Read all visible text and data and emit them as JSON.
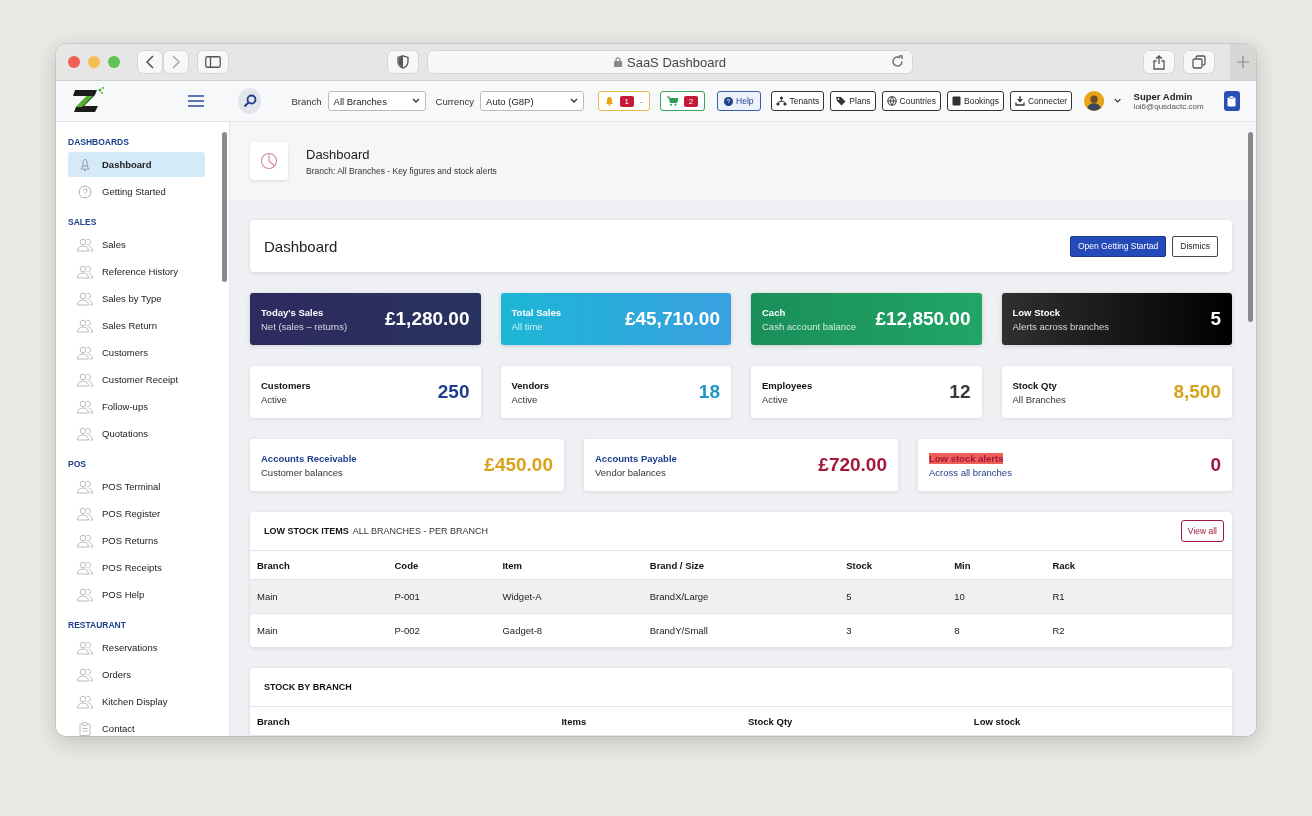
{
  "browser": {
    "address": "SaaS Dashboard"
  },
  "header": {
    "branch_label": "Branch",
    "branch_value": "All Branches",
    "currency_label": "Currency",
    "currency_value": "Auto (G8P)",
    "alerts": [
      {
        "kind": "bell",
        "count": "1",
        "extra": "-"
      },
      {
        "kind": "cart",
        "count": "2"
      }
    ],
    "help": "Help",
    "links": [
      {
        "kind": "tenants",
        "label": "Tenants"
      },
      {
        "kind": "plans",
        "label": "Plans"
      },
      {
        "kind": "countries",
        "label": "Countries"
      },
      {
        "kind": "bookings",
        "label": "Bookings"
      },
      {
        "kind": "connecter",
        "label": "Connecter"
      }
    ],
    "user": {
      "name": "Super Admin",
      "email": "ioi6@qusdactc.com"
    }
  },
  "sidebar": {
    "sections": [
      {
        "title": "DASHBOARDS",
        "items": [
          {
            "label": "Dashboard",
            "kind": "rocket",
            "selected": true
          },
          {
            "label": "Getting Started",
            "kind": "help",
            "selected": false
          }
        ]
      },
      {
        "title": "SALES",
        "items": [
          {
            "label": "Sales",
            "kind": "users",
            "selected": false
          },
          {
            "label": "Reference History",
            "kind": "users",
            "selected": false
          },
          {
            "label": "Sales by Type",
            "kind": "users",
            "selected": false
          },
          {
            "label": "Sales Return",
            "kind": "users",
            "selected": false
          },
          {
            "label": "Customers",
            "kind": "users",
            "selected": false
          },
          {
            "label": "Customer Receipt",
            "kind": "users",
            "selected": false
          },
          {
            "label": "Follow-ups",
            "kind": "users",
            "selected": false
          },
          {
            "label": "Quotations",
            "kind": "users",
            "selected": false
          }
        ]
      },
      {
        "title": "POS",
        "items": [
          {
            "label": "POS Terminal",
            "kind": "users",
            "selected": false
          },
          {
            "label": "POS Register",
            "kind": "users",
            "selected": false
          },
          {
            "label": "POS Returns",
            "kind": "users",
            "selected": false
          },
          {
            "label": "POS Receipts",
            "kind": "users",
            "selected": false
          },
          {
            "label": "POS Help",
            "kind": "users",
            "selected": false
          }
        ]
      },
      {
        "title": "RESTAURANT",
        "items": [
          {
            "label": "Reservations",
            "kind": "users",
            "selected": false
          },
          {
            "label": "Orders",
            "kind": "users",
            "selected": false
          },
          {
            "label": "Kitchen Display",
            "kind": "users",
            "selected": false
          },
          {
            "label": "Contact",
            "kind": "clipboard",
            "selected": false
          }
        ]
      }
    ]
  },
  "page_header": {
    "title": "Dashboard",
    "subtitle": "Branch: All Branches - Key figures and stock alerts"
  },
  "dashboard_bar": {
    "title": "Dashboard",
    "primary_button": "Open Getting Startad",
    "secondary_button": "Dismics"
  },
  "summary_cards": [
    {
      "kind": "indigo",
      "title": "Today's Sales",
      "subtitle": "Net (sales – returns)",
      "value": "£1,280.00"
    },
    {
      "kind": "cyan",
      "title": "Total Sales",
      "subtitle": "All time",
      "value": "£45,710.00"
    },
    {
      "kind": "green",
      "title": "Cach",
      "subtitle": "Cash account balance",
      "value": "£12,850.00"
    },
    {
      "kind": "black",
      "title": "Low Stock",
      "subtitle": "Alerts across branches",
      "value": "5"
    }
  ],
  "count_cards": [
    {
      "title": "Customers",
      "subtitle": "Active",
      "value": "250",
      "color": "#1e3f8c"
    },
    {
      "title": "Vendors",
      "subtitle": "Active",
      "value": "18",
      "color": "#2196c9"
    },
    {
      "title": "Employees",
      "subtitle": "Active",
      "value": "12",
      "color": "#333a40"
    },
    {
      "title": "Stock Qty",
      "subtitle": "All Branches",
      "value": "8,500",
      "color": "#d9a21b"
    }
  ],
  "balance_cards": [
    {
      "kind": "balance",
      "title": "Accounts Receivable",
      "subtitle": "Customer balances",
      "value": "£450.00",
      "color": "#d9a21b"
    },
    {
      "kind": "balance",
      "title": "Accounts Payable",
      "subtitle": "Vendor balances",
      "value": "£720.00",
      "color": "#a3173a"
    },
    {
      "kind": "alert",
      "title": "Low stock alerts",
      "subtitle": "Across all branches",
      "value": "0",
      "color": "#a3173a"
    }
  ],
  "low_stock_table": {
    "title": "LOW STOCK ITEMS",
    "subtitle": "ALL BRANCHES - PER BRANCH",
    "button": "View all",
    "columns": [
      "Branch",
      "Code",
      "Item",
      "Brand / Size",
      "Stock",
      "Min",
      "Rack"
    ],
    "rows": [
      [
        "Main",
        "P-001",
        "Widget-A",
        "BrandX/Large",
        "5",
        "10",
        "R1"
      ],
      [
        "Main",
        "P-002",
        "Gadget-8",
        "BrandY/Small",
        "3",
        "8",
        "R2"
      ]
    ]
  },
  "stock_by_branch": {
    "title": "STOCK BY BRANCH",
    "columns": [
      "Branch",
      "Items",
      "Stock Qty",
      "Low stock"
    ]
  }
}
